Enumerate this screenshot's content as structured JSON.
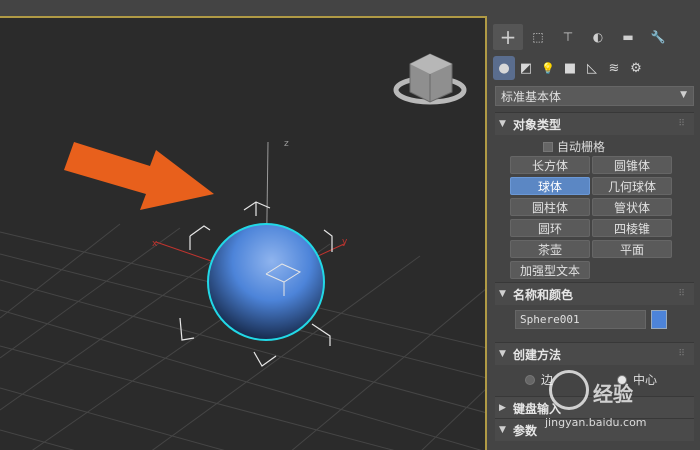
{
  "command_panel": {
    "tabs": [
      {
        "icon": "plus-icon",
        "glyph": "+"
      },
      {
        "icon": "modify-icon",
        "glyph": "⬚"
      },
      {
        "icon": "hierarchy-icon",
        "glyph": "⊤"
      },
      {
        "icon": "motion-icon",
        "glyph": "◐"
      },
      {
        "icon": "display-icon",
        "glyph": "▬"
      },
      {
        "icon": "utilities-icon",
        "glyph": "🔧"
      }
    ],
    "subtabs": [
      {
        "icon": "geometry-icon",
        "glyph": "●"
      },
      {
        "icon": "shapes-icon",
        "glyph": "◩"
      },
      {
        "icon": "lights-icon",
        "glyph": "💡"
      },
      {
        "icon": "cameras-icon",
        "glyph": "■"
      },
      {
        "icon": "helpers-icon",
        "glyph": "◺"
      },
      {
        "icon": "spacewarps-icon",
        "glyph": "≋"
      },
      {
        "icon": "systems-icon",
        "glyph": "⚙"
      }
    ],
    "category_dropdown": "标准基本体",
    "object_type": {
      "title": "对象类型",
      "autogrid_label": "自动栅格",
      "buttons": [
        "长方体",
        "圆锥体",
        "球体",
        "几何球体",
        "圆柱体",
        "管状体",
        "圆环",
        "四棱锥",
        "茶壶",
        "平面",
        "加强型文本"
      ],
      "active": "球体"
    },
    "name_color": {
      "title": "名称和颜色",
      "name_value": "Sphere001",
      "color": "#4d84d9"
    },
    "creation_method": {
      "title": "创建方法",
      "option_edge": "边",
      "option_center": "中心"
    },
    "keyboard_entry": {
      "title": "键盘输入"
    },
    "parameters": {
      "title": "参数"
    }
  },
  "viewport": {
    "gizmo_axes": {
      "x": "x",
      "y": "y",
      "z": "z"
    },
    "sphere_color": "#4d84d9",
    "arrow_color": "#e8601c"
  },
  "watermark": {
    "brand": "经验",
    "url": "jingyan.baidu.com"
  }
}
